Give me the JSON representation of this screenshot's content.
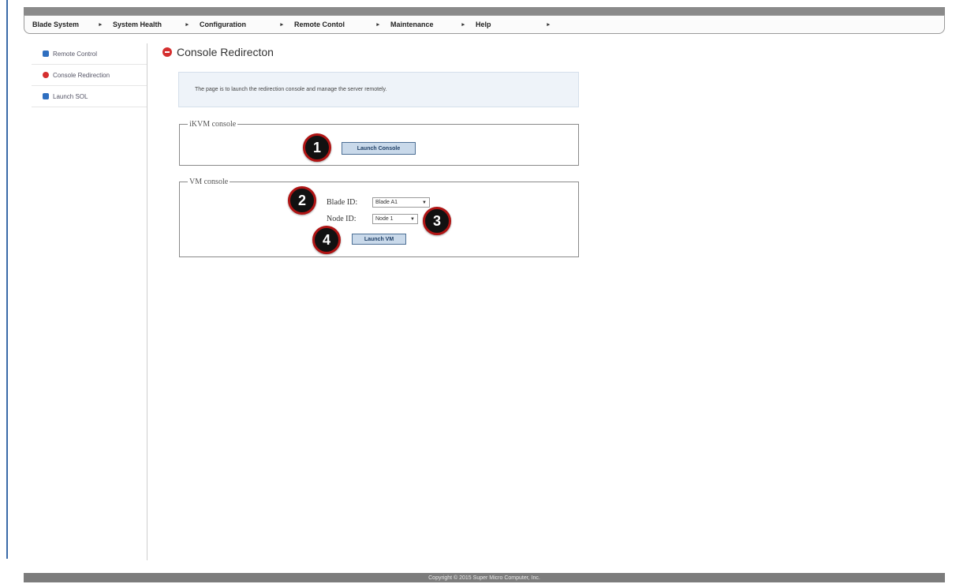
{
  "menu": {
    "items": [
      {
        "label": "Blade System"
      },
      {
        "label": "System Health"
      },
      {
        "label": "Configuration"
      },
      {
        "label": "Remote Contol"
      },
      {
        "label": "Maintenance"
      },
      {
        "label": "Help"
      }
    ],
    "arrow": "▸"
  },
  "sidebar": {
    "items": [
      {
        "label": "Remote Control",
        "icon": "blue-square-icon"
      },
      {
        "label": "Console Redirection",
        "icon": "red-circle-icon"
      },
      {
        "label": "Launch SOL",
        "icon": "blue-square-icon"
      }
    ]
  },
  "page": {
    "title": "Console Redirecton",
    "description": "The page is to launch the redirection console and manage the server remotely."
  },
  "kvm": {
    "legend": "iKVM console",
    "launch_label": "Launch Console"
  },
  "vm": {
    "legend": "VM console",
    "blade_label": "Blade ID:",
    "blade_value": "Blade A1",
    "node_label": "Node ID:",
    "node_value": "Node 1",
    "launch_label": "Launch VM"
  },
  "markers": [
    "1",
    "2",
    "3",
    "4"
  ],
  "footer": {
    "text": "Copyright © 2015 Super Micro Computer, Inc."
  },
  "colors": {
    "accent_red": "#d52f2f",
    "accent_blue": "#2f6fc0",
    "marker_border": "#b01414"
  }
}
